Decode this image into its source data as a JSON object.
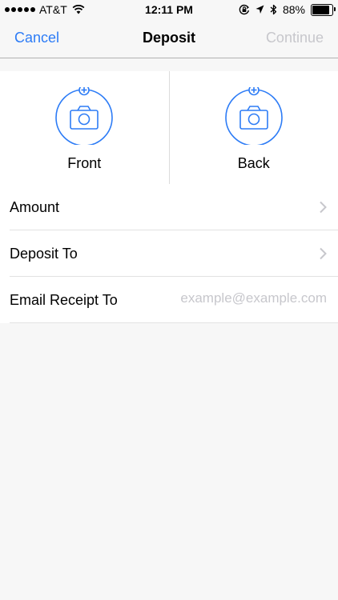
{
  "status_bar": {
    "carrier": "AT&T",
    "time": "12:11 PM",
    "battery_percent": "88%",
    "battery_level": 0.88,
    "icons": [
      "signal-dots-icon",
      "wifi-icon",
      "orientation-lock-icon",
      "location-arrow-icon",
      "bluetooth-icon",
      "battery-icon"
    ]
  },
  "nav": {
    "cancel_label": "Cancel",
    "title": "Deposit",
    "continue_label": "Continue",
    "continue_enabled": false
  },
  "capture": {
    "front_label": "Front",
    "back_label": "Back",
    "icon": "camera-add-icon",
    "accent_color": "#2d7cf6"
  },
  "form": {
    "amount_label": "Amount",
    "deposit_to_label": "Deposit To",
    "email_label": "Email Receipt To",
    "email_value": "",
    "email_placeholder": "example@example.com"
  }
}
